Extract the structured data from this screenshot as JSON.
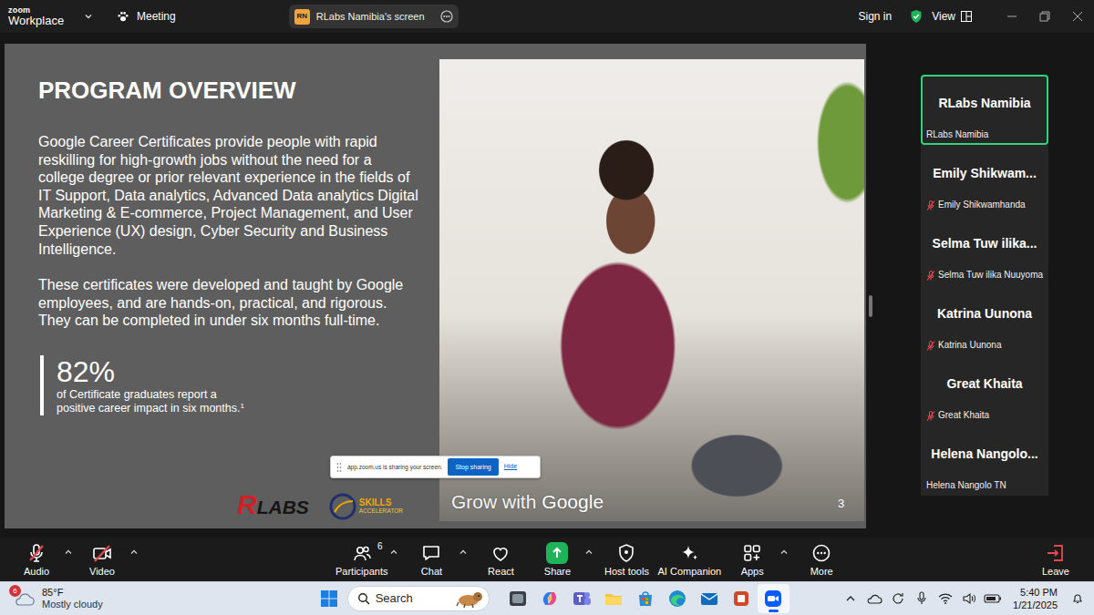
{
  "window": {
    "logo": "zoom",
    "product": "Workplace",
    "meeting_label": "Meeting",
    "share_tab": {
      "badge": "RN",
      "title": "RLabs Namibia's screen"
    },
    "sign_in": "Sign in",
    "view": "View"
  },
  "slide": {
    "title": "PROGRAM OVERVIEW",
    "paragraphs": [
      "Google Career Certificates provide people with rapid reskilling for high-growth jobs without the need for a college degree or prior relevant experience in the fields of IT Support, Data analytics, Advanced Data analytics Digital Marketing & E-commerce, Project Management, and User Experience (UX) design, Cyber Security and Business Intelligence.",
      "These certificates were developed and taught by Google employees, and are hands-on, practical, and rigorous. They can be completed in under six months full-time."
    ],
    "stat": {
      "value": "82%",
      "caption_lines": [
        "of Certificate graduates report a",
        "positive career impact in six months."
      ],
      "footnote": "1"
    },
    "logos": {
      "rlabs_mark": "R",
      "rlabs_word": "LABS",
      "skills_top": "SKILLS",
      "skills_bottom": "ACCELERATOR"
    },
    "brand": {
      "prefix": "Grow with",
      "name": "Google"
    },
    "page": "3"
  },
  "share_notice": {
    "text": "app.zoom.us is sharing your screen.",
    "stop": "Stop sharing",
    "hide": "Hide"
  },
  "participants": [
    {
      "tile_name": "RLabs Namibia",
      "label": "RLabs Namibia",
      "muted": false,
      "selected": true
    },
    {
      "tile_name": "Emily Shikwam...",
      "label": "Emily Shikwamhanda",
      "muted": true,
      "selected": false
    },
    {
      "tile_name": "Selma Tuw ilika...",
      "label": "Selma Tuw ilika Nuuyoma",
      "muted": true,
      "selected": false
    },
    {
      "tile_name": "Katrina Uunona",
      "label": "Katrina Uunona",
      "muted": true,
      "selected": false
    },
    {
      "tile_name": "Great Khaita",
      "label": "Great Khaita",
      "muted": true,
      "selected": false
    },
    {
      "tile_name": "Helena Nangolo...",
      "label": "Helena Nangolo TN",
      "muted": false,
      "selected": false
    }
  ],
  "toolbar": {
    "left": [
      {
        "label": "Audio",
        "off": true,
        "has_menu": true
      },
      {
        "label": "Video",
        "off": true,
        "has_menu": true
      }
    ],
    "center": [
      {
        "label": "Participants",
        "count": "6",
        "has_menu": true,
        "highlighted": false
      },
      {
        "label": "Chat",
        "has_menu": true,
        "highlighted": false
      },
      {
        "label": "React",
        "has_menu": false,
        "highlighted": false
      },
      {
        "label": "Share",
        "has_menu": true,
        "highlighted": true
      },
      {
        "label": "Host tools",
        "has_menu": false,
        "highlighted": false
      },
      {
        "label": "AI Companion",
        "has_menu": false,
        "highlighted": false
      },
      {
        "label": "Apps",
        "has_menu": true,
        "highlighted": false
      },
      {
        "label": "More",
        "has_menu": false,
        "highlighted": false
      }
    ],
    "leave": {
      "label": "Leave"
    }
  },
  "taskbar": {
    "weather": {
      "badge": "6",
      "temp": "85°F",
      "condition": "Mostly cloudy"
    },
    "search": {
      "placeholder": "Search"
    },
    "apps": [
      {
        "selected": false
      },
      {
        "selected": false
      },
      {
        "selected": false
      },
      {
        "selected": false
      },
      {
        "selected": false
      },
      {
        "selected": false
      },
      {
        "selected": false
      },
      {
        "selected": false
      },
      {
        "selected": true
      }
    ],
    "clock": {
      "time": "5:40 PM",
      "date": "1/21/2025"
    }
  }
}
